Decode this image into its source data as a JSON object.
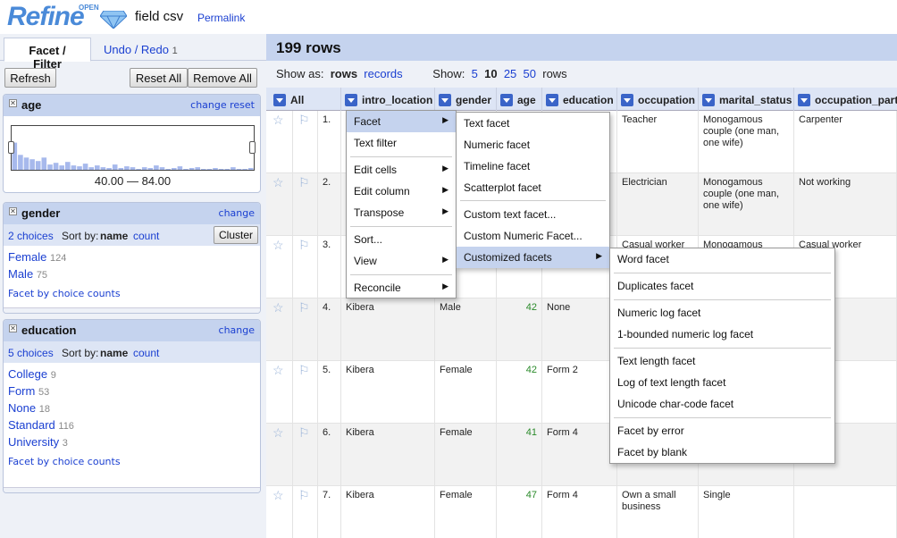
{
  "header": {
    "project_name": "field csv",
    "permalink": "Permalink",
    "logo_open": "OPEN",
    "logo_refine": "Refine"
  },
  "left": {
    "tabs": {
      "facet": "Facet / Filter",
      "undo": "Undo / Redo",
      "undo_count": "1"
    },
    "refresh": "Refresh",
    "reset_all": "Reset All",
    "remove_all": "Remove All",
    "age": {
      "title": "age",
      "change": "change",
      "reset": "reset",
      "range": "40.00 — 84.00",
      "histogram": [
        0.62,
        0.34,
        0.28,
        0.24,
        0.2,
        0.28,
        0.12,
        0.16,
        0.1,
        0.18,
        0.1,
        0.08,
        0.14,
        0.06,
        0.1,
        0.06,
        0.04,
        0.12,
        0.04,
        0.08,
        0.06,
        0.02,
        0.06,
        0.04,
        0.1,
        0.06,
        0.02,
        0.04,
        0.08,
        0.02,
        0.04,
        0.06,
        0.02,
        0.02,
        0.04,
        0.02,
        0.02,
        0.06,
        0.02,
        0.02,
        0.04
      ]
    },
    "gender": {
      "title": "gender",
      "change": "change",
      "choices": "2 choices",
      "sort_by": "Sort by:",
      "sort_name": "name",
      "sort_count": "count",
      "cluster": "Cluster",
      "items": [
        {
          "label": "Female",
          "count": "124"
        },
        {
          "label": "Male",
          "count": "75"
        }
      ],
      "facet_by_counts": "Facet by choice counts"
    },
    "education": {
      "title": "education",
      "change": "change",
      "choices": "5 choices",
      "sort_by": "Sort by:",
      "sort_name": "name",
      "sort_count": "count",
      "items": [
        {
          "label": "College",
          "count": "9"
        },
        {
          "label": "Form",
          "count": "53"
        },
        {
          "label": "None",
          "count": "18"
        },
        {
          "label": "Standard",
          "count": "116"
        },
        {
          "label": "University",
          "count": "3"
        }
      ],
      "facet_by_counts": "Facet by choice counts"
    }
  },
  "right": {
    "rowcount": "199 rows",
    "view": {
      "show_as": "Show as:",
      "rows": "rows",
      "records": "records",
      "show": "Show:",
      "p5": "5",
      "p10": "10",
      "p25": "25",
      "p50": "50",
      "rows2": "rows"
    },
    "columns": [
      "All",
      "intro_location",
      "gender",
      "age",
      "education",
      "occupation",
      "marital_status",
      "occupation_part"
    ],
    "rows": [
      {
        "n": "1.",
        "loc": "",
        "gender": "",
        "age": "",
        "edu": "",
        "occ": "Teacher",
        "marital": "Monogamous couple (one man, one wife)",
        "part": "Carpenter"
      },
      {
        "n": "2.",
        "loc": "",
        "gender": "",
        "age": "",
        "edu": "",
        "occ": "Electrician",
        "marital": "Monogamous couple (one man, one wife)",
        "part": "Not working"
      },
      {
        "n": "3.",
        "loc": "",
        "gender": "",
        "age": "",
        "edu": "",
        "occ": "Casual worker",
        "marital": "Monogamous",
        "part": "Casual worker"
      },
      {
        "n": "4.",
        "loc": "Kibera",
        "gender": "Male",
        "age": "42",
        "edu": "None",
        "occ": "",
        "marital": "",
        "part": ""
      },
      {
        "n": "5.",
        "loc": "Kibera",
        "gender": "Female",
        "age": "42",
        "edu": "Form 2",
        "occ": "",
        "marital": "",
        "part": ""
      },
      {
        "n": "6.",
        "loc": "Kibera",
        "gender": "Female",
        "age": "41",
        "edu": "Form 4",
        "occ": "",
        "marital": "",
        "part": ""
      },
      {
        "n": "7.",
        "loc": "Kibera",
        "gender": "Female",
        "age": "47",
        "edu": "Form 4",
        "occ": "Own a small business",
        "marital": "Single",
        "part": ""
      }
    ]
  },
  "menu1": [
    "Facet",
    "Text filter",
    "Edit cells",
    "Edit column",
    "Transpose",
    "Sort...",
    "View",
    "Reconcile"
  ],
  "menu2": [
    "Text facet",
    "Numeric facet",
    "Timeline facet",
    "Scatterplot facet",
    "Custom text facet...",
    "Custom Numeric Facet...",
    "Customized facets"
  ],
  "menu3": [
    "Word facet",
    "Duplicates facet",
    "Numeric log facet",
    "1-bounded numeric log facet",
    "Text length facet",
    "Log of text length facet",
    "Unicode char-code facet",
    "Facet by error",
    "Facet by blank"
  ]
}
